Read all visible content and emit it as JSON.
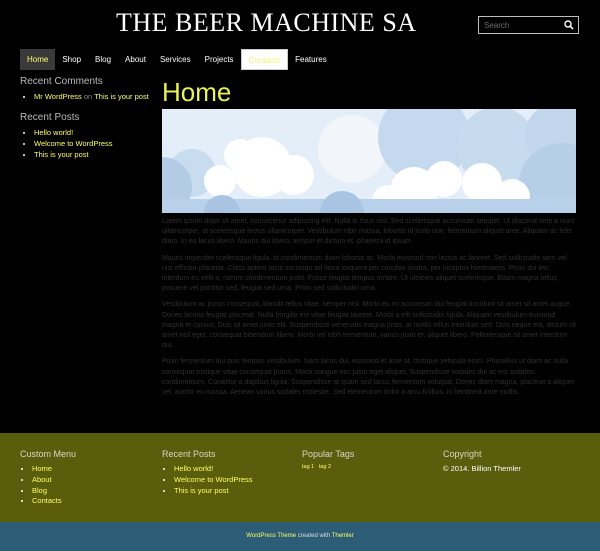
{
  "header": {
    "site_title": "THE BEER MACHINE SA",
    "search_placeholder": "Search",
    "search_icon": "search-icon"
  },
  "nav": {
    "items": [
      "Home",
      "Shop",
      "Blog",
      "About",
      "Services",
      "Projects",
      "Contacts",
      "Features"
    ],
    "active": "Home"
  },
  "sidebar": {
    "recent_comments_title": "Recent Comments",
    "comment": {
      "author": "Mr WordPress",
      "on": "on",
      "post": "This is your post"
    },
    "recent_posts_title": "Recent Posts",
    "posts": [
      "Hello world!",
      "Welcome to WordPress",
      "This is your post"
    ]
  },
  "main": {
    "title": "Home",
    "paragraphs": [
      "Lorem ipsum dolor sit amet, consectetur adipiscing elit. Nulla in risus nisl. Sed scelerisque accumsan semper. Ut placerat sem a nunc ullamcorper, at scelerisque lectus ullamcorper. Vestibulum nibh massa, lobortis id justo non, fermentum aliquet ante. Aliquam ac felis diam. In eu lacus libero. Mauris dui libero, tempor et dictum et, pharetra id ipsum.",
      "Mauris imperdiet scelerisque ligula, id condimentum diam lobortis ac. Morbi euismod non lectus ac laoreet. Sed sollicitudin sem vel nisi efficitur placerat. Class aptent taciti sociosqu ad litora torquent per conubia nostra, per inceptos himenaeos. Proin dui leo, interdum eu velit a, rutrum condimentum justo. Fusce feugiat tempus ornare. Ut ultricies aliquet scelerisque. Etiam magna tellus, posuere vel porttitor sed, feugiat sed urna. Proin sed sollicitudin urna.",
      "Vestibulum ac purus consequat, blandit tellus vitae, semper nisl. Morbi eu mi accumsan dui feugiat tincidunt sit amet sit amet augue. Donec lacinia feugiat placerat. Nulla fringilla est vitae feugiat laoreet. Morbi a elit sollicitudin ligula. Aliquam vestibulum euismod magna et cursus. Duis sit amet justo elit. Suspendisse venenatis magna justo, at mollis tellus interdum sed. Duis neque est, dictum sit amet nisl eget, consequat bibendum libero. Morbi vel nibh fermentum, varius justo et, aliquet libero. Pellentesque sit amet interdum dui.",
      "Proin fermentum dui quis tempus vestibulum. Nam lacus dui, euismod et ante at, tristique vehicula enim. Phasellus ut diam ac nulla consequat tristique vitae consequat purus. Morbi congue nec justo eget aliquet. Suspendisse sodales dui ac est sodales condimentum. Curabitur a dapibus ligula. Suspendisse at quam sed lacus fermentum volutpat. Donec diam magna, placerat a aliquet vel, auctor eu massa. Aenean varius sodales molestie. Sed elementum dolor a arcu finibus, in hendrerit ante mollis."
    ]
  },
  "footer": {
    "custom_menu_title": "Custom Menu",
    "menu_items": [
      "Home",
      "About",
      "Blog",
      "Contacts"
    ],
    "recent_posts_title": "Recent Posts",
    "recent_posts": [
      "Hello world!",
      "Welcome to WordPress",
      "This is your post"
    ],
    "popular_tags_title": "Popular Tags",
    "tags": [
      "tag 1",
      "tag 2"
    ],
    "copyright_title": "Copyright",
    "copyright_text": "© 2014. Billion Themler"
  },
  "bottom_bar": {
    "link1": "WordPress Theme",
    "middle": "created with",
    "link2": "Themler"
  },
  "colors": {
    "background": "#000000",
    "accent": "#ffff66",
    "title": "#e8f05a",
    "footer": "#5a5d0b",
    "bottom_bar": "#2d5c77"
  }
}
